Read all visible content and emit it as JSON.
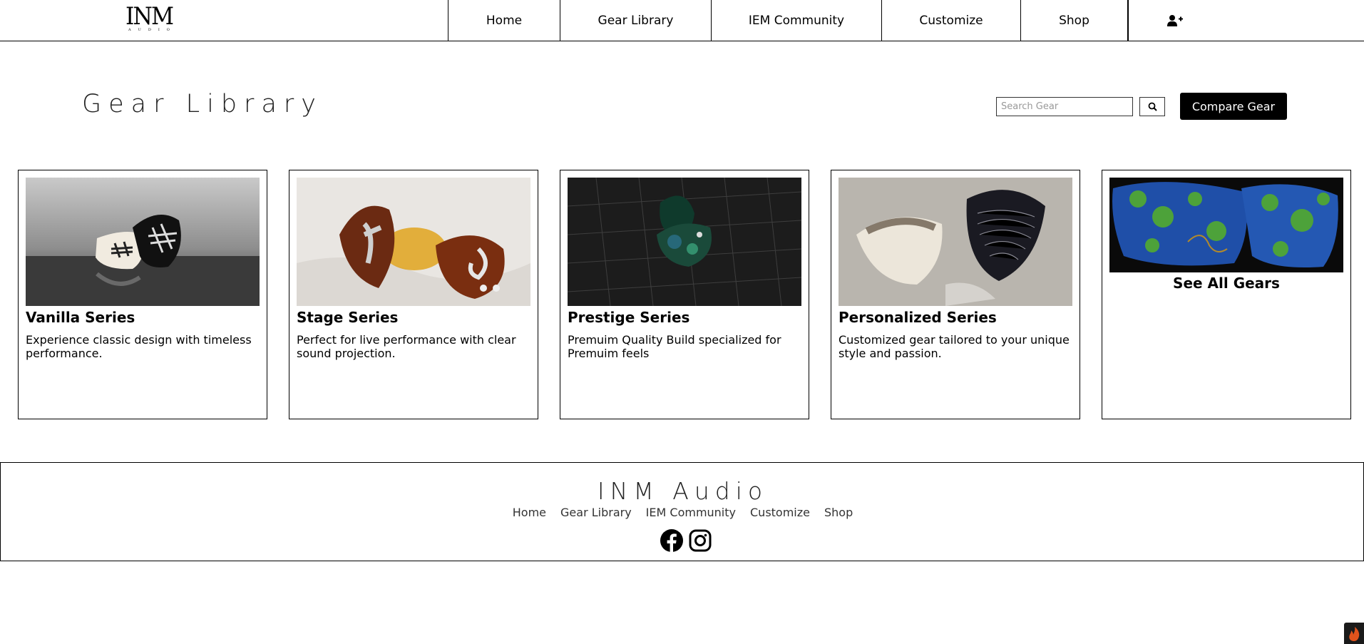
{
  "logo": {
    "mark": "INM",
    "sub": "AUDIO"
  },
  "nav": {
    "items": [
      {
        "label": "Home"
      },
      {
        "label": "Gear Library"
      },
      {
        "label": "IEM Community"
      },
      {
        "label": "Customize"
      },
      {
        "label": "Shop"
      }
    ],
    "account_icon": "user-plus-icon"
  },
  "page": {
    "title": "Gear Library",
    "search_placeholder": "Search Gear",
    "search_icon": "search-icon",
    "compare_label": "Compare Gear"
  },
  "cards": [
    {
      "name": "Vanilla Series",
      "desc": "Experience classic design with timeless performance."
    },
    {
      "name": "Stage Series",
      "desc": "Perfect for live performance with clear sound projection."
    },
    {
      "name": "Prestige Series",
      "desc": "Premuim Quality Build specialized for Premuim feels"
    },
    {
      "name": "Personalized Series",
      "desc": "Customized gear tailored to your unique style and passion."
    },
    {
      "name": "See All Gears"
    }
  ],
  "footer": {
    "title": "INM Audio",
    "links": [
      "Home",
      "Gear Library",
      "IEM Community",
      "Customize",
      "Shop"
    ],
    "social_icons": [
      "facebook-icon",
      "instagram-icon"
    ]
  }
}
